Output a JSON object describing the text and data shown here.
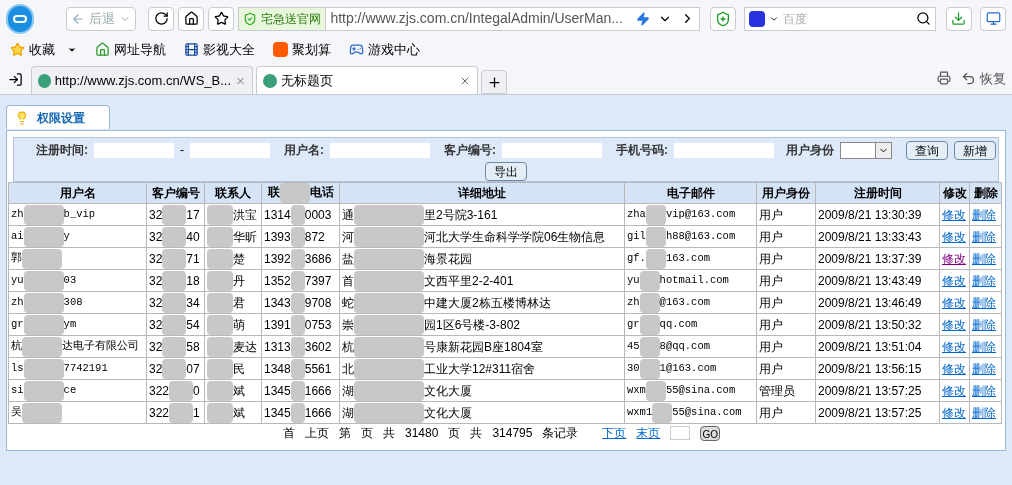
{
  "browser": {
    "back_label": "后退",
    "security_label": "宅急送官网",
    "url": "http://www.zjs.com.cn/IntegalAdmin/UserMan...",
    "search_placeholder": "百度"
  },
  "bookmarks": [
    {
      "label": "收藏",
      "kind": "star",
      "dropdown": true
    },
    {
      "label": "网址导航",
      "kind": "house",
      "dropdown": false
    },
    {
      "label": "影视大全",
      "kind": "film",
      "dropdown": false
    },
    {
      "label": "聚划算",
      "kind": "tao",
      "dropdown": false
    },
    {
      "label": "游戏中心",
      "kind": "game",
      "dropdown": false
    }
  ],
  "tabs": [
    {
      "title": "http://www.zjs.com.cn/WS_B...",
      "selected": false
    },
    {
      "title": "无标题页",
      "selected": true
    }
  ],
  "restore_label": "恢复",
  "page_tab": "权限设置",
  "filters": {
    "reg_time_label": "注册时间:",
    "range_sep": "-",
    "username_label": "用户名:",
    "customer_no_label": "客户编号:",
    "phone_label": "手机号码:",
    "role_label": "用户身份",
    "search_button": "查询",
    "add_button": "新增",
    "export_button": "导出"
  },
  "table": {
    "columns": [
      {
        "label": "用户名"
      },
      {
        "label": "客户编号"
      },
      {
        "label": "联系人"
      },
      {
        "label": "联",
        "label_after": "电话"
      },
      {
        "label": "详细地址"
      },
      {
        "label": "电子邮件"
      },
      {
        "label": "用户身份"
      },
      {
        "label": "注册时间"
      },
      {
        "label": "修改"
      },
      {
        "label": "删除"
      }
    ],
    "rows": [
      {
        "username": {
          "parts": [
            "zh",
            "b_vip"
          ],
          "kind": "blur_middle"
        },
        "customer_no": {
          "parts": [
            "32",
            "17"
          ],
          "kind": "blur_middle"
        },
        "contact": {
          "parts": [
            "洪宝"
          ],
          "kind": "blur_before"
        },
        "phone": {
          "parts": [
            "1314",
            "0003"
          ],
          "kind": "blur_middle"
        },
        "address": {
          "parts": [
            "通",
            "里2号院3-161"
          ],
          "kind": "blur_middle"
        },
        "email": {
          "parts": [
            "zha",
            "vip@163.com"
          ],
          "kind": "blur_middle"
        },
        "role": "用户",
        "registered": "2009/8/21 13:30:39",
        "edit": {
          "label": "修改",
          "visited": false
        },
        "delete": "删除"
      },
      {
        "username": {
          "parts": [
            "ai",
            "y"
          ],
          "kind": "blur_middle"
        },
        "customer_no": {
          "parts": [
            "32",
            "40"
          ],
          "kind": "blur_middle"
        },
        "contact": {
          "parts": [
            "华昕"
          ],
          "kind": "blur_before"
        },
        "phone": {
          "parts": [
            "1393",
            "872"
          ],
          "kind": "blur_middle"
        },
        "address": {
          "parts": [
            "河",
            "河北大学生命科学学院06生物信息"
          ],
          "kind": "blur_middle"
        },
        "email": {
          "parts": [
            "gil",
            "h88@163.com"
          ],
          "kind": "blur_middle"
        },
        "role": "用户",
        "registered": "2009/8/21 13:33:43",
        "edit": {
          "label": "修改",
          "visited": false
        },
        "delete": "删除"
      },
      {
        "username": {
          "parts": [
            "郭"
          ],
          "kind": "blur_after"
        },
        "customer_no": {
          "parts": [
            "32",
            "71"
          ],
          "kind": "blur_middle"
        },
        "contact": {
          "parts": [
            "楚"
          ],
          "kind": "blur_before"
        },
        "phone": {
          "parts": [
            "1392",
            "3686"
          ],
          "kind": "blur_middle"
        },
        "address": {
          "parts": [
            "盐",
            "海景花园"
          ],
          "kind": "blur_middle"
        },
        "email": {
          "parts": [
            "gf.",
            "163.com"
          ],
          "kind": "blur_middle"
        },
        "role": "用户",
        "registered": "2009/8/21 13:37:39",
        "edit": {
          "label": "修改",
          "visited": true
        },
        "delete": "删除"
      },
      {
        "username": {
          "parts": [
            "yu",
            "03"
          ],
          "kind": "blur_middle"
        },
        "customer_no": {
          "parts": [
            "32",
            "18"
          ],
          "kind": "blur_middle"
        },
        "contact": {
          "parts": [
            "丹"
          ],
          "kind": "blur_before"
        },
        "phone": {
          "parts": [
            "1352",
            "7397"
          ],
          "kind": "blur_middle"
        },
        "address": {
          "parts": [
            "首",
            "文西平里2-2-401"
          ],
          "kind": "blur_middle"
        },
        "email": {
          "parts": [
            "yu",
            "hotmail.com"
          ],
          "kind": "blur_middle"
        },
        "role": "用户",
        "registered": "2009/8/21 13:43:49",
        "edit": {
          "label": "修改",
          "visited": false
        },
        "delete": "删除"
      },
      {
        "username": {
          "parts": [
            "zh",
            "308"
          ],
          "kind": "blur_middle"
        },
        "customer_no": {
          "parts": [
            "32",
            "34"
          ],
          "kind": "blur_middle"
        },
        "contact": {
          "parts": [
            "君"
          ],
          "kind": "blur_before"
        },
        "phone": {
          "parts": [
            "1343",
            "9708"
          ],
          "kind": "blur_middle"
        },
        "address": {
          "parts": [
            "蛇",
            "中建大厦2栋五楼博林达"
          ],
          "kind": "blur_middle"
        },
        "email": {
          "parts": [
            "zh",
            "@163.com"
          ],
          "kind": "blur_middle"
        },
        "role": "用户",
        "registered": "2009/8/21 13:46:49",
        "edit": {
          "label": "修改",
          "visited": false
        },
        "delete": "删除"
      },
      {
        "username": {
          "parts": [
            "gr",
            "ym"
          ],
          "kind": "blur_middle"
        },
        "customer_no": {
          "parts": [
            "32",
            "54"
          ],
          "kind": "blur_middle"
        },
        "contact": {
          "parts": [
            "萌"
          ],
          "kind": "blur_before"
        },
        "phone": {
          "parts": [
            "1391",
            "0753"
          ],
          "kind": "blur_middle"
        },
        "address": {
          "parts": [
            "崇",
            "园1区6号楼-3-802"
          ],
          "kind": "blur_middle"
        },
        "email": {
          "parts": [
            "gr",
            "qq.com"
          ],
          "kind": "blur_middle"
        },
        "role": "用户",
        "registered": "2009/8/21 13:50:32",
        "edit": {
          "label": "修改",
          "visited": false
        },
        "delete": "删除"
      },
      {
        "username": {
          "parts": [
            "杭",
            "达电子有限公司"
          ],
          "kind": "blur_middle"
        },
        "customer_no": {
          "parts": [
            "32",
            "58"
          ],
          "kind": "blur_middle"
        },
        "contact": {
          "parts": [
            "麦达"
          ],
          "kind": "blur_before"
        },
        "phone": {
          "parts": [
            "1313",
            "3602"
          ],
          "kind": "blur_middle"
        },
        "address": {
          "parts": [
            "杭",
            "号康新花园B座1804室"
          ],
          "kind": "blur_middle"
        },
        "email": {
          "parts": [
            "45",
            "8@qq.com"
          ],
          "kind": "blur_middle"
        },
        "role": "用户",
        "registered": "2009/8/21 13:51:04",
        "edit": {
          "label": "修改",
          "visited": false
        },
        "delete": "删除"
      },
      {
        "username": {
          "parts": [
            "ls",
            "7742191"
          ],
          "kind": "blur_middle"
        },
        "customer_no": {
          "parts": [
            "32",
            "07"
          ],
          "kind": "blur_middle"
        },
        "contact": {
          "parts": [
            "民"
          ],
          "kind": "blur_before"
        },
        "phone": {
          "parts": [
            "1348",
            "5561"
          ],
          "kind": "blur_middle"
        },
        "address": {
          "parts": [
            "北",
            "工业大学12#311宿舍"
          ],
          "kind": "blur_middle"
        },
        "email": {
          "parts": [
            "30",
            "1@163.com"
          ],
          "kind": "blur_middle"
        },
        "role": "用户",
        "registered": "2009/8/21 13:56:15",
        "edit": {
          "label": "修改",
          "visited": false
        },
        "delete": "删除"
      },
      {
        "username": {
          "parts": [
            "si",
            "ce"
          ],
          "kind": "blur_middle"
        },
        "customer_no": {
          "parts": [
            "322",
            "0"
          ],
          "kind": "blur_middle"
        },
        "contact": {
          "parts": [
            "斌"
          ],
          "kind": "blur_before"
        },
        "phone": {
          "parts": [
            "1345",
            "1666"
          ],
          "kind": "blur_middle"
        },
        "address": {
          "parts": [
            "湖",
            "文化大厦"
          ],
          "kind": "blur_middle"
        },
        "email": {
          "parts": [
            "wxm",
            "55@sina.com"
          ],
          "kind": "blur_middle"
        },
        "role": "管理员",
        "registered": "2009/8/21 13:57:25",
        "edit": {
          "label": "修改",
          "visited": false
        },
        "delete": "删除"
      },
      {
        "username": {
          "parts": [
            "吴"
          ],
          "kind": "blur_after"
        },
        "customer_no": {
          "parts": [
            "322",
            "1"
          ],
          "kind": "blur_middle"
        },
        "contact": {
          "parts": [
            "斌"
          ],
          "kind": "blur_before"
        },
        "phone": {
          "parts": [
            "1345",
            "1666"
          ],
          "kind": "blur_middle"
        },
        "address": {
          "parts": [
            "湖",
            "文化大厦"
          ],
          "kind": "blur_middle"
        },
        "email": {
          "parts": [
            "wxm1",
            "55@sina.com"
          ],
          "kind": "blur_middle"
        },
        "role": "用户",
        "registered": "2009/8/21 13:57:25",
        "edit": {
          "label": "修改",
          "visited": false
        },
        "delete": "删除"
      }
    ]
  },
  "pager": {
    "texts": [
      "首",
      "上页",
      "第",
      "页",
      "共",
      "31480",
      "页",
      "共",
      "314795",
      "条记录"
    ],
    "links": [
      "下页",
      "末页"
    ],
    "go_button": "GO"
  }
}
